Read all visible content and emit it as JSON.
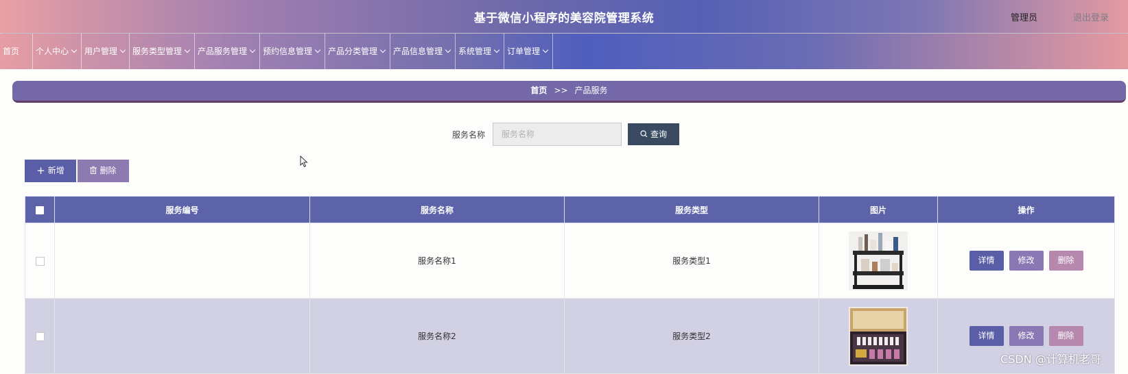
{
  "header": {
    "title": "基于微信小程序的美容院管理系统",
    "user": "管理员",
    "logout": "退出登录"
  },
  "nav": [
    {
      "label": "首页",
      "has_dropdown": false
    },
    {
      "label": "个人中心",
      "has_dropdown": true
    },
    {
      "label": "用户管理",
      "has_dropdown": true
    },
    {
      "label": "服务类型管理",
      "has_dropdown": true
    },
    {
      "label": "产品服务管理",
      "has_dropdown": true
    },
    {
      "label": "预约信息管理",
      "has_dropdown": true
    },
    {
      "label": "产品分类管理",
      "has_dropdown": true
    },
    {
      "label": "产品信息管理",
      "has_dropdown": true
    },
    {
      "label": "系统管理",
      "has_dropdown": true
    },
    {
      "label": "订单管理",
      "has_dropdown": true
    }
  ],
  "breadcrumb": {
    "home": "首页",
    "separator": ">>",
    "current": "产品服务"
  },
  "search": {
    "label": "服务名称",
    "placeholder": "服务名称",
    "value": "",
    "button": "查询"
  },
  "actions": {
    "add": "新增",
    "delete": "删除"
  },
  "table": {
    "columns": [
      "服务编号",
      "服务名称",
      "服务类型",
      "图片",
      "操作"
    ],
    "rows": [
      {
        "id": "",
        "name": "服务名称1",
        "type": "服务类型1",
        "image": "cosmetics-cart-photo",
        "checked": false
      },
      {
        "id": "",
        "name": "服务名称2",
        "type": "服务类型2",
        "image": "skincare-giftbox-photo",
        "checked": false
      }
    ],
    "row_actions": {
      "detail": "详情",
      "edit": "修改",
      "delete": "删除"
    }
  },
  "watermark": "CSDN @计算机老哥",
  "colors": {
    "header_start": "#e8a0a4",
    "header_mid": "#5560b4",
    "accent": "#5c63a9",
    "breadcrumb": "#7468a8",
    "query_button": "#3a4a60",
    "row_alt": "#d2d0e3"
  }
}
